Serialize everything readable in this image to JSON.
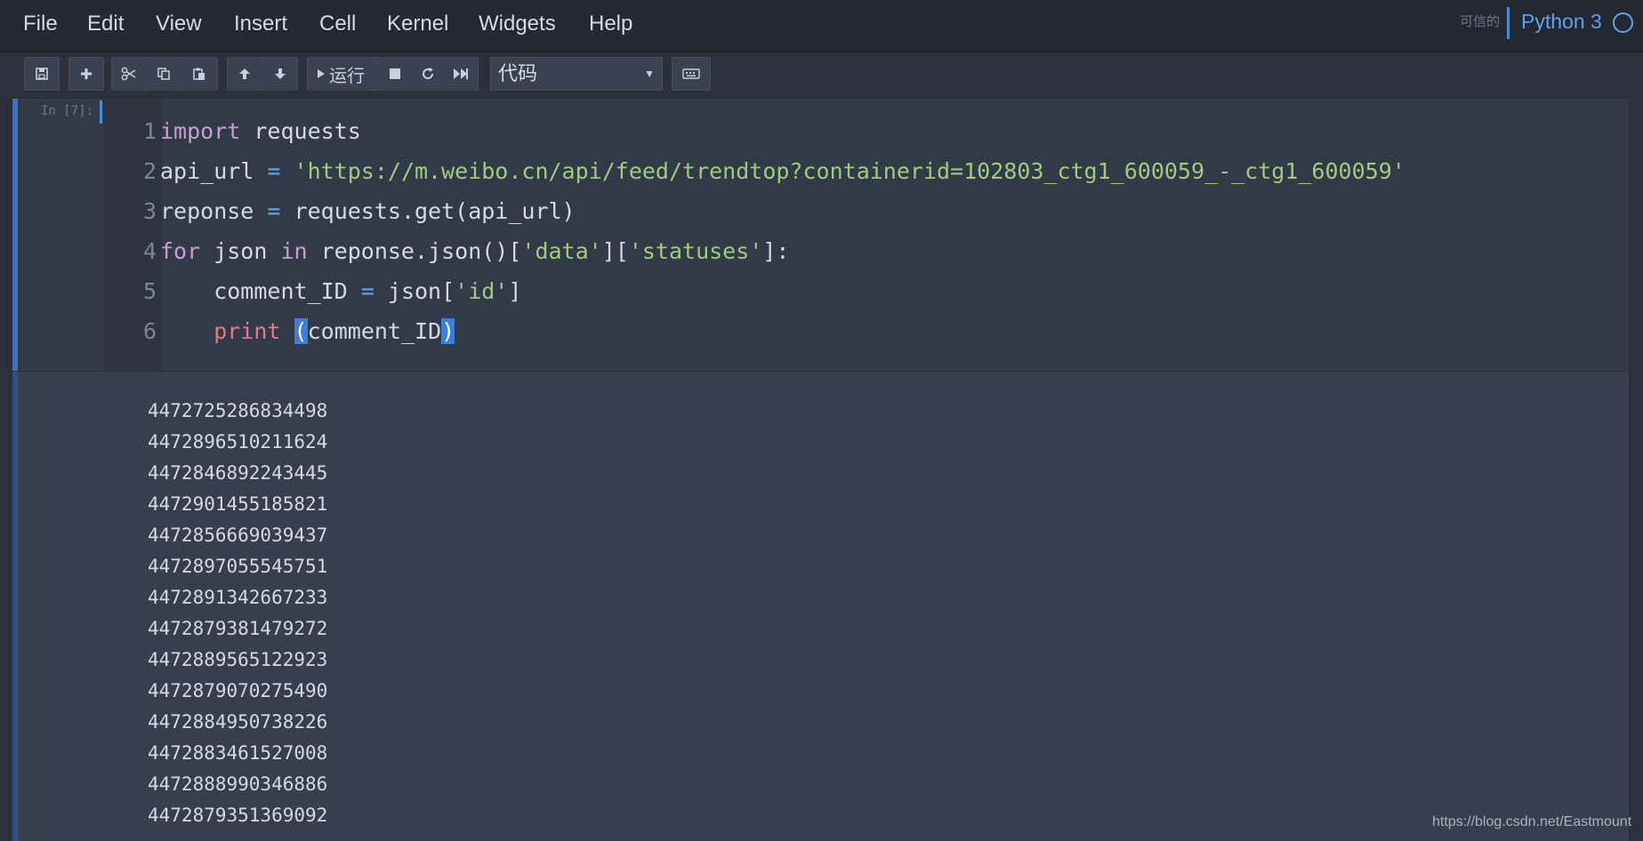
{
  "menu": [
    "File",
    "Edit",
    "View",
    "Insert",
    "Cell",
    "Kernel",
    "Widgets",
    "Help"
  ],
  "header": {
    "trusted": "可信的",
    "kernel": "Python 3"
  },
  "toolbar": {
    "run_label": "运行",
    "cell_type": "代码"
  },
  "cell": {
    "prompt": "In [7]:",
    "line_numbers": [
      "1",
      "2",
      "3",
      "4",
      "5",
      "6"
    ],
    "code": {
      "l1_kw": "import",
      "l1_rest": " requests",
      "l2_var": "api_url ",
      "l2_op": "=",
      "l2_str": " 'https://m.weibo.cn/api/feed/trendtop?containerid=102803_ctg1_600059_-_ctg1_600059'",
      "l3_var": "reponse ",
      "l3_op": "=",
      "l3_rest": " requests.get(api_url)",
      "l4_kw1": "for",
      "l4_mid1": " json ",
      "l4_kw2": "in",
      "l4_mid2": " reponse.json()[",
      "l4_str1": "'data'",
      "l4_mid3": "][",
      "l4_str2": "'statuses'",
      "l4_end": "]:",
      "l5_var": "    comment_ID ",
      "l5_op": "=",
      "l5_mid": " json[",
      "l5_str": "'id'",
      "l5_end": "]",
      "l6_indent": "    ",
      "l6_bi": "print",
      "l6_sp": " ",
      "l6_open": "(",
      "l6_arg": "comment_ID",
      "l6_close": ")"
    }
  },
  "output": [
    "4472725286834498",
    "4472896510211624",
    "4472846892243445",
    "4472901455185821",
    "4472856669039437",
    "4472897055545751",
    "4472891342667233",
    "4472879381479272",
    "4472889565122923",
    "4472879070275490",
    "4472884950738226",
    "4472883461527008",
    "4472888990346886",
    "4472879351369092"
  ],
  "watermark": "https://blog.csdn.net/Eastmount"
}
